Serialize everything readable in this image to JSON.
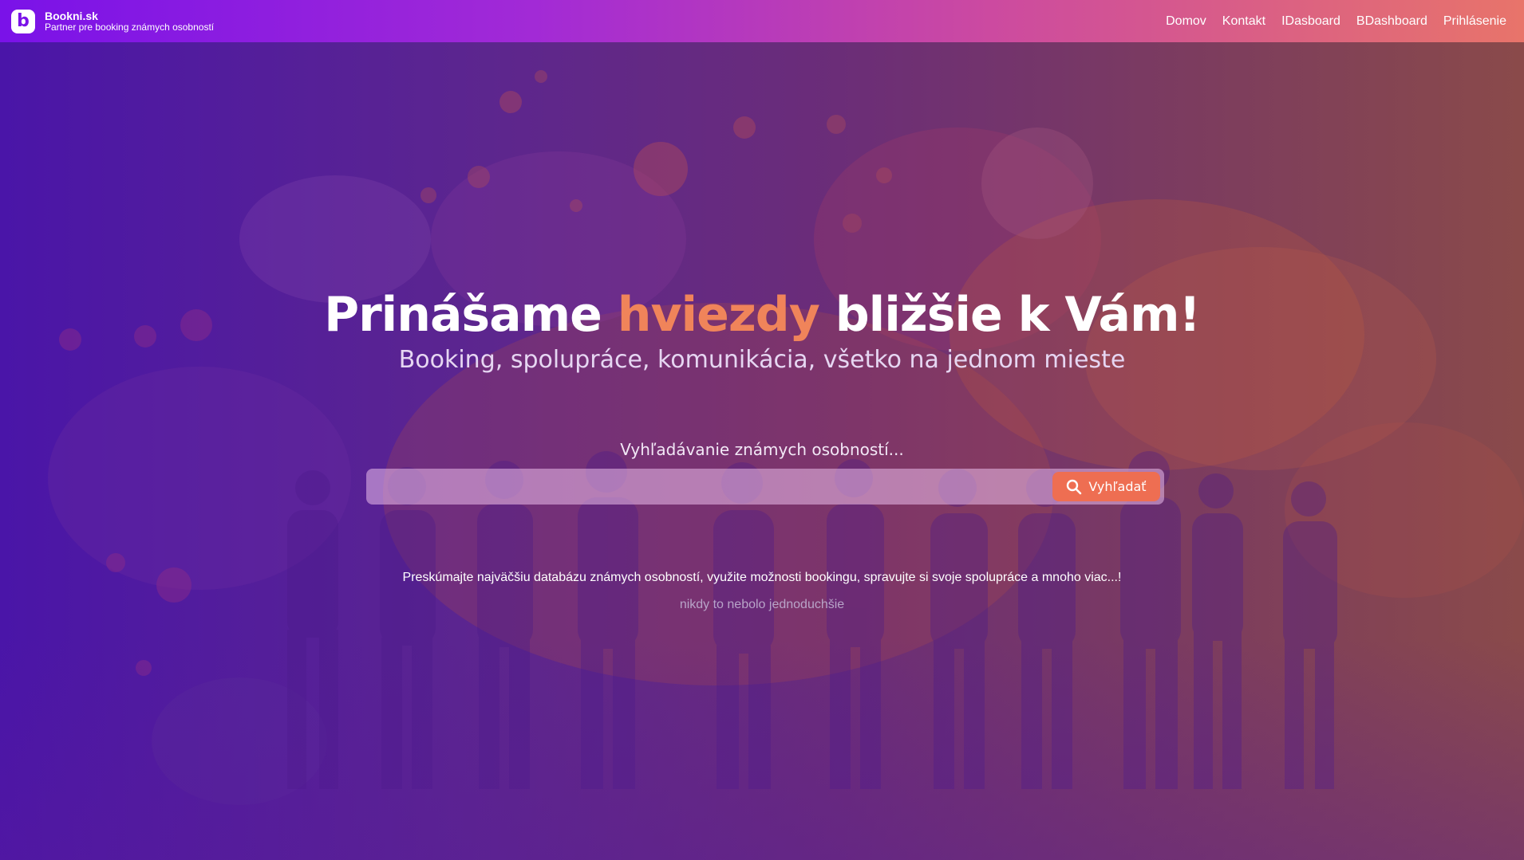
{
  "colors": {
    "nav_gradient_start": "#7a12e8",
    "nav_gradient_end": "#e8746a",
    "accent": "#f0845a",
    "search_button": "#ee6e52"
  },
  "navbar": {
    "brand_name": "Bookni.sk",
    "brand_tagline": "Partner pre booking známych osobností",
    "logo_letter": "b",
    "links": [
      {
        "label": "Domov"
      },
      {
        "label": "Kontakt"
      },
      {
        "label": "IDasboard"
      },
      {
        "label": "BDashboard"
      },
      {
        "label": "Prihlásenie"
      }
    ]
  },
  "hero": {
    "headline_before": "Prinášame ",
    "headline_accent": "hviezdy",
    "headline_after": " bližšie k Vám!",
    "subheadline": "Booking, spolupráce, komunikácia, všetko na jednom mieste",
    "search_label": "Vyhľadávanie známych osobností...",
    "search_value": "",
    "search_button_label": "Vyhľadať",
    "search_button_icon": "search-icon",
    "description": "Preskúmajte najväčšiu databázu známych osobností, využite možnosti bookingu, spravujte si svoje spolupráce a mnoho viac...!",
    "tagline": "nikdy to nebolo jednoduchšie"
  }
}
